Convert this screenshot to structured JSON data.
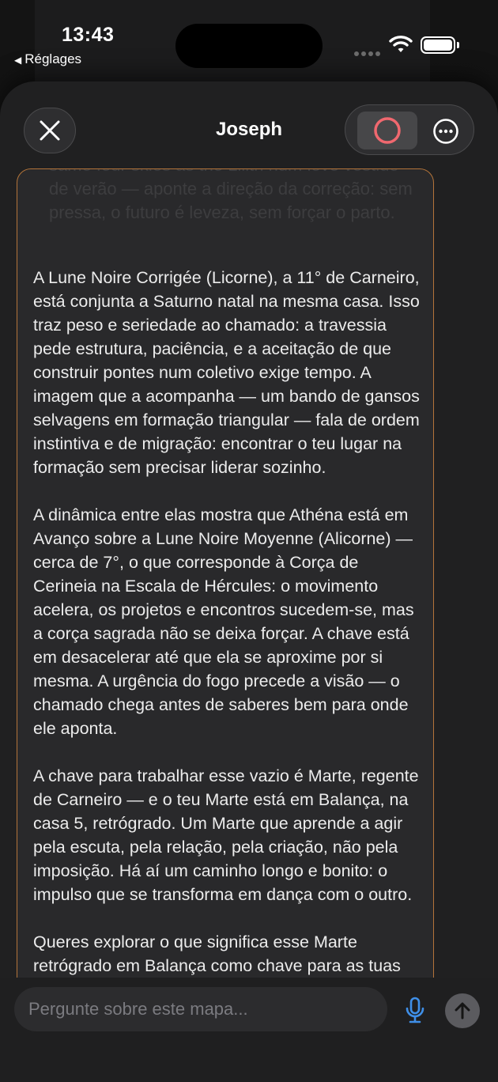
{
  "status_bar": {
    "time": "13:43",
    "back_label": "Réglages",
    "icons": [
      "signal-dots-icon",
      "wifi-icon",
      "battery-icon"
    ]
  },
  "header": {
    "title": "Joseph",
    "close_icon": "close-icon",
    "record_icon": "record-icon",
    "more_icon": "more-options-icon"
  },
  "background_text": "Hoje: Vênus faz facilmente com Lua para você — a leveza do modo detalhe, num modo leve está dourado. Mars e Mercury, evoque from the same four skies as the Lilith num leve vestido de verão — aponte a direção da correção: sem pressa, o futuro é leveza, sem forçar o parto.",
  "message": {
    "paragraphs": [
      "A Lune Noire Corrigée (Licorne), a 11° de Carneiro, está conjunta a Saturno natal na mesma casa. Isso traz peso e seriedade ao chamado: a travessia pede estrutura, paciência, e a aceitação de que construir pontes num coletivo exige tempo. A imagem que a acompanha — um bando de gansos selvagens em formação triangular — fala de ordem instintiva e de migração: encontrar o teu lugar na formação sem precisar liderar sozinho.",
      "A dinâmica entre elas mostra que Athéna está em Avanço sobre a Lune Noire Moyenne (Alicorne) — cerca de 7°, o que corresponde à Corça de Cerineia na Escala de Hércules: o movimento acelera, os projetos e encontros sucedem-se, mas a corça sagrada não se deixa forçar. A chave está em desacelerar até que ela se aproxime por si mesma. A urgência do fogo precede a visão — o chamado chega antes de saberes bem para onde ele aponta.",
      "A chave para trabalhar esse vazio é Marte, regente de Carneiro — e o teu Marte está em Balança, na casa 5, retrógrado. Um Marte que aprende a agir pela escuta, pela relação, pela criação, não pela imposição. Há aí um caminho longo e bonito: o impulso que se transforma em dança com o outro.",
      "Queres explorar o que significa esse Marte retrógrado em Balança como chave para as tuas Luas Negras?"
    ],
    "border_color": "#b3743a"
  },
  "composer": {
    "placeholder": "Pergunte sobre este mapa...",
    "value": "",
    "mic_icon": "microphone-icon",
    "send_icon": "send-arrow-up-icon",
    "accent_color": "#3f8fe8"
  },
  "colors": {
    "sheet_bg": "#202021",
    "bubble_bg": "#29292b",
    "record_ring": "#f0686f"
  }
}
